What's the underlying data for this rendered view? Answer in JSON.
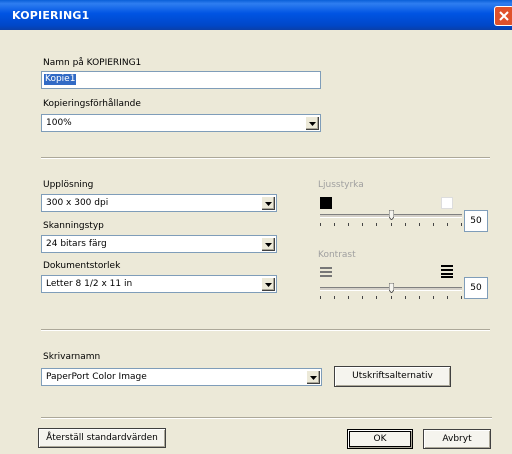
{
  "window": {
    "title": "KOPIERING1"
  },
  "name_field": {
    "label": "Namn på KOPIERING1",
    "value": "Kopie1"
  },
  "ratio": {
    "label": "Kopieringsförhållande",
    "value": "100%"
  },
  "resolution": {
    "label": "Upplösning",
    "value": "300 x 300 dpi"
  },
  "scan_type": {
    "label": "Skanningstyp",
    "value": "24 bitars färg"
  },
  "doc_size": {
    "label": "Dokumentstorlek",
    "value": "Letter 8 1/2 x 11 in"
  },
  "brightness": {
    "label": "Ljusstyrka",
    "value": "50",
    "level": 0.5
  },
  "contrast": {
    "label": "Kontrast",
    "value": "50",
    "level": 0.5
  },
  "printer": {
    "label": "Skrivarnamn",
    "value": "PaperPort Color Image",
    "options_button": "Utskriftsalternativ"
  },
  "footer": {
    "reset_button": "Återställ standardvärden",
    "ok_button": "OK",
    "cancel_button": "Avbryt"
  },
  "colors": {
    "title_bar": "#0054e3",
    "dialog_bg": "#ece9d8",
    "selection": "#316ac5",
    "close_button": "#e0512b"
  }
}
